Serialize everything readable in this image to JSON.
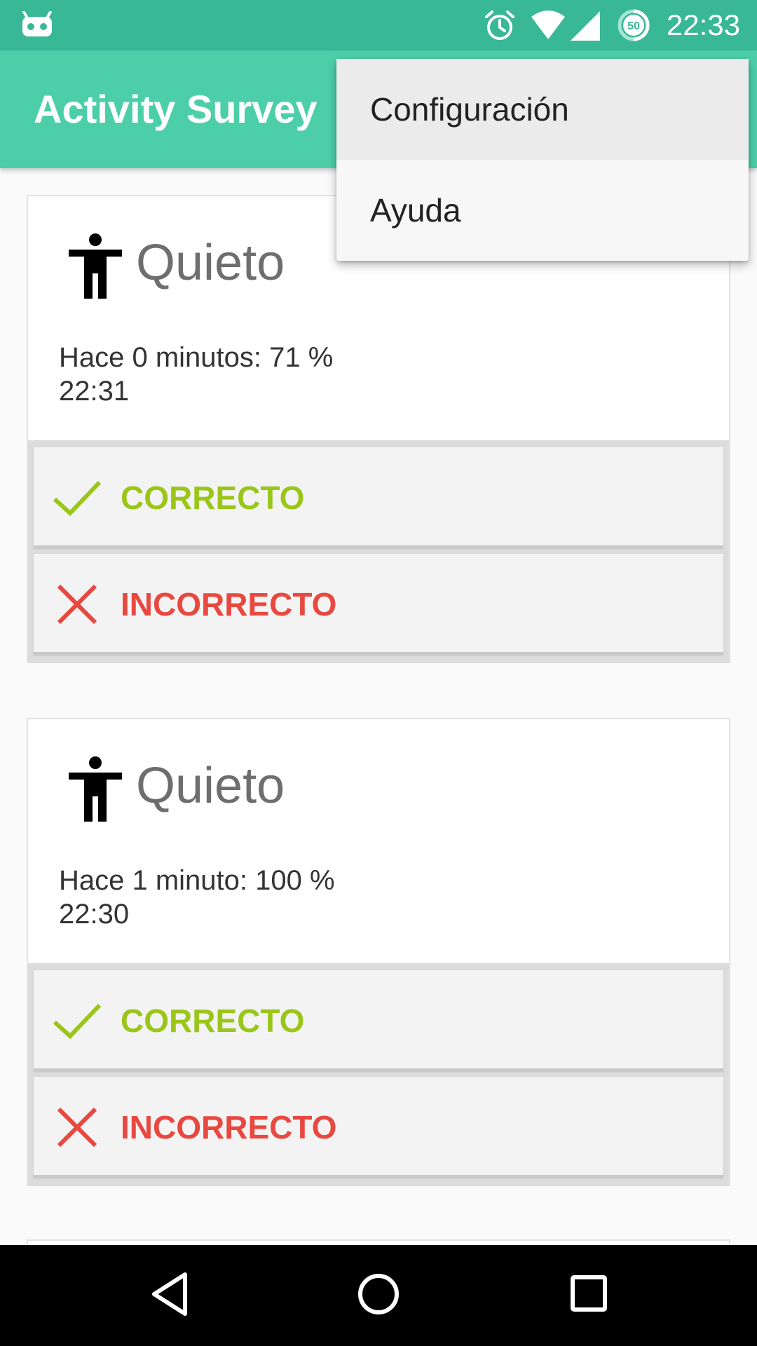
{
  "status_bar": {
    "time": "22:33",
    "battery_level": "50",
    "icons": [
      "android-robot-icon",
      "alarm-icon",
      "wifi-icon",
      "signal-icon",
      "battery-icon"
    ]
  },
  "app_bar": {
    "title": "Activity Survey",
    "color": "#4ccfa8"
  },
  "menu": {
    "items": [
      {
        "label": "Configuración",
        "highlighted": true
      },
      {
        "label": "Ayuda",
        "highlighted": false
      }
    ]
  },
  "cards": [
    {
      "icon": "person-standing-icon",
      "activity": "Quieto",
      "detail": "Hace 0 minutos: 71 %",
      "time": "22:31",
      "correct_label": "CORRECTO",
      "incorrect_label": "INCORRECTO"
    },
    {
      "icon": "person-standing-icon",
      "activity": "Quieto",
      "detail": "Hace 1 minuto: 100 %",
      "time": "22:30",
      "correct_label": "CORRECTO",
      "incorrect_label": "INCORRECTO"
    }
  ],
  "colors": {
    "status_bar": "#38b896",
    "correct": "#9ac619",
    "incorrect": "#e8483f"
  },
  "nav_bar": {
    "icons": [
      "back-icon",
      "home-icon",
      "recents-icon"
    ]
  }
}
